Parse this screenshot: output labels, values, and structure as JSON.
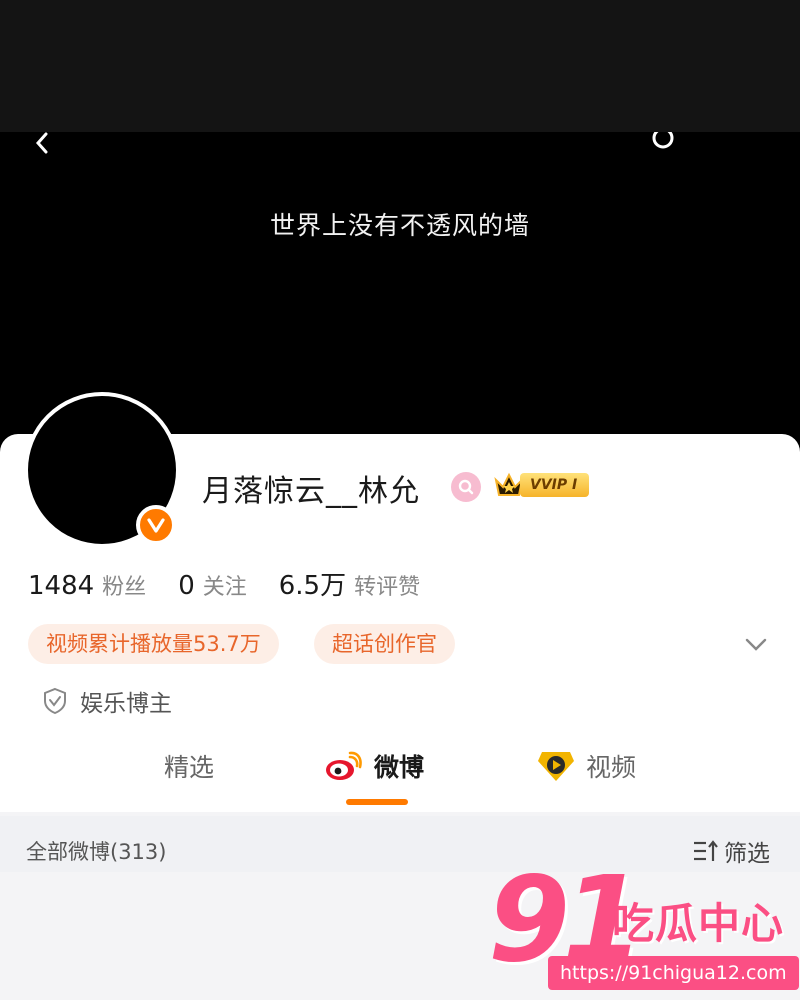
{
  "cover": {
    "text": "世界上没有不透风的墙"
  },
  "profile": {
    "username": "月落惊云__林允",
    "vip_label": "VVIP Ⅰ"
  },
  "stats": [
    {
      "num": "1484",
      "label": "粉丝"
    },
    {
      "num": "0",
      "label": "关注"
    },
    {
      "num": "6.5万",
      "label": "转评赞"
    }
  ],
  "tags": [
    {
      "text": "视频累计播放量53.7万"
    },
    {
      "text": "超话创作官"
    }
  ],
  "certification": "娱乐博主",
  "tabs": [
    {
      "label": "精选"
    },
    {
      "label": "微博",
      "active": true
    },
    {
      "label": "视频"
    }
  ],
  "feed": {
    "count_label": "全部微博(313)",
    "filter_label": "筛选"
  },
  "watermark": {
    "big": "91",
    "title": "吃瓜中心",
    "url": "https://91chigua12.com"
  },
  "colors": {
    "accent": "#ff7a00",
    "tag_bg": "#fdeee6",
    "tag_text": "#e8662b",
    "watermark": "#fb4f84"
  },
  "icons": [
    "back-icon",
    "more-icon",
    "verified-v-icon",
    "search-badge-icon",
    "crown-icon",
    "chevron-down-icon",
    "shield-icon",
    "weibo-logo-icon",
    "video-play-icon",
    "filter-icon"
  ]
}
